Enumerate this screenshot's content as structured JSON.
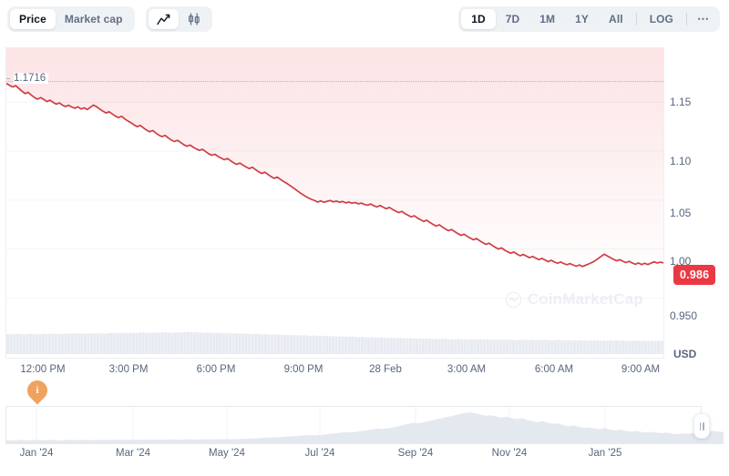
{
  "toolbar": {
    "metric_buttons": [
      {
        "label": "Price",
        "active": true
      },
      {
        "label": "Market cap",
        "active": false
      }
    ],
    "chart_type_buttons": [
      {
        "icon": "line-chart-icon",
        "active": true
      },
      {
        "icon": "candlestick-chart-icon",
        "active": false
      }
    ],
    "range_buttons": [
      {
        "label": "1D",
        "active": true
      },
      {
        "label": "7D",
        "active": false
      },
      {
        "label": "1M",
        "active": false
      },
      {
        "label": "1Y",
        "active": false
      },
      {
        "label": "All",
        "active": false
      }
    ],
    "log_label": "LOG",
    "more_label": "⋯"
  },
  "chart": {
    "ath_label": "1.1716",
    "current_price": "0.986",
    "currency": "USD",
    "watermark": "CoinMarketCap",
    "flag_label": "i",
    "accent_color": "#ea3943",
    "line_color": "#cf3d43",
    "flag_color": "#f0a35e"
  },
  "chart_data": {
    "type": "line",
    "title": "",
    "subtitle": "",
    "xlabel": "",
    "ylabel": "USD",
    "ylim": [
      0.93,
      1.1716
    ],
    "grid": true,
    "legend": false,
    "annotations": [
      {
        "type": "hline",
        "value": 1.1716,
        "label": "1.1716",
        "style": "dotted"
      },
      {
        "type": "price-badge",
        "value": 0.986,
        "label": "0.986"
      },
      {
        "type": "flag",
        "x": "12:00 PM",
        "label": "i"
      }
    ],
    "yticks": [
      1.15,
      1.1,
      1.05,
      1.0,
      0.95
    ],
    "ytick_labels": [
      "1.15",
      "1.10",
      "1.05",
      "1.00",
      "0.950"
    ],
    "xticks": [
      "12:00 PM",
      "3:00 PM",
      "6:00 PM",
      "9:00 PM",
      "28 Feb",
      "3:00 AM",
      "6:00 AM",
      "9:00 AM"
    ],
    "series": [
      {
        "name": "Price",
        "color": "#cf3d43",
        "fill": "rgba(234,57,67,0.10)",
        "values": [
          1.169,
          1.1672,
          1.1655,
          1.1668,
          1.164,
          1.1612,
          1.1588,
          1.16,
          1.1572,
          1.1548,
          1.153,
          1.1546,
          1.1528,
          1.1506,
          1.152,
          1.1498,
          1.148,
          1.1492,
          1.147,
          1.1455,
          1.1468,
          1.145,
          1.1438,
          1.1452,
          1.143,
          1.1442,
          1.1425,
          1.1448,
          1.147,
          1.1452,
          1.143,
          1.1408,
          1.139,
          1.1402,
          1.138,
          1.1358,
          1.1342,
          1.1356,
          1.133,
          1.1308,
          1.129,
          1.1268,
          1.125,
          1.1262,
          1.1238,
          1.1215,
          1.1198,
          1.121,
          1.1185,
          1.1162,
          1.1148,
          1.116,
          1.1135,
          1.1112,
          1.1098,
          1.111,
          1.1088,
          1.1065,
          1.105,
          1.1062,
          1.104,
          1.1022,
          1.1008,
          1.1018,
          1.0995,
          1.0972,
          1.0958,
          1.0968,
          1.0945,
          1.0928,
          1.0912,
          1.0925,
          1.0902,
          1.088,
          1.0865,
          1.0878,
          1.0856,
          1.0838,
          1.0822,
          1.0835,
          1.0812,
          1.079,
          1.0772,
          1.0785,
          1.0762,
          1.074,
          1.0722,
          1.0735,
          1.0712,
          1.069,
          1.0672,
          1.065,
          1.0628,
          1.0605,
          1.0582,
          1.056,
          1.054,
          1.0522,
          1.0508,
          1.0495,
          1.048,
          1.0492,
          1.0478,
          1.0488,
          1.0496,
          1.0482,
          1.049,
          1.0478,
          1.0486,
          1.0472,
          1.048,
          1.0468,
          1.0476,
          1.0462,
          1.047,
          1.0455,
          1.0448,
          1.046,
          1.0442,
          1.043,
          1.0445,
          1.0428,
          1.0412,
          1.0425,
          1.0405,
          1.0388,
          1.0372,
          1.0385,
          1.0362,
          1.0345,
          1.0328,
          1.034,
          1.0318,
          1.03,
          1.0282,
          1.0295,
          1.0272,
          1.0252,
          1.0235,
          1.0248,
          1.0225,
          1.0205,
          1.0188,
          1.02,
          1.0178,
          1.0158,
          1.014,
          1.0152,
          1.013,
          1.0112,
          1.0095,
          1.0108,
          1.0085,
          1.0065,
          1.0048,
          1.006,
          1.0038,
          1.0018,
          1.0,
          1.0012,
          0.999,
          0.9972,
          0.9958,
          0.997,
          0.9948,
          0.9932,
          0.9945,
          0.9928,
          0.9912,
          0.9925,
          0.9908,
          0.9892,
          0.9905,
          0.9888,
          0.9872,
          0.9885,
          0.9868,
          0.9855,
          0.9868,
          0.9852,
          0.984,
          0.9852,
          0.9838,
          0.9825,
          0.9838,
          0.9822,
          0.9835,
          0.9848,
          0.9862,
          0.988,
          0.9902,
          0.9925,
          0.9948,
          0.993,
          0.9912,
          0.9895,
          0.988,
          0.9892,
          0.9875,
          0.9862,
          0.9875,
          0.9858,
          0.9845,
          0.9858,
          0.9842,
          0.9855,
          0.9842,
          0.9856,
          0.987,
          0.9858,
          0.9866,
          0.986
        ]
      }
    ],
    "volume_series": {
      "name": "Volume",
      "color": "#e7ebf1",
      "values": [
        0.72,
        0.73,
        0.72,
        0.74,
        0.73,
        0.72,
        0.73,
        0.74,
        0.73,
        0.72,
        0.73,
        0.74,
        0.73,
        0.74,
        0.75,
        0.74,
        0.73,
        0.74,
        0.75,
        0.74,
        0.75,
        0.76,
        0.75,
        0.74,
        0.75,
        0.76,
        0.75,
        0.76,
        0.77,
        0.76,
        0.75,
        0.76,
        0.77,
        0.76,
        0.77,
        0.78,
        0.77,
        0.76,
        0.77,
        0.78,
        0.77,
        0.78,
        0.79,
        0.78,
        0.77,
        0.78,
        0.79,
        0.78,
        0.79,
        0.8,
        0.79,
        0.78,
        0.79,
        0.8,
        0.79,
        0.8,
        0.81,
        0.8,
        0.79,
        0.8,
        0.79,
        0.78,
        0.79,
        0.78,
        0.77,
        0.78,
        0.77,
        0.76,
        0.77,
        0.76,
        0.75,
        0.76,
        0.75,
        0.74,
        0.75,
        0.74,
        0.73,
        0.74,
        0.73,
        0.72,
        0.73,
        0.72,
        0.71,
        0.72,
        0.71,
        0.7,
        0.71,
        0.7,
        0.69,
        0.7,
        0.69,
        0.68,
        0.69,
        0.68,
        0.67,
        0.68,
        0.67,
        0.66,
        0.67,
        0.66,
        0.65,
        0.66,
        0.65,
        0.64,
        0.65,
        0.64,
        0.63,
        0.64,
        0.63,
        0.62,
        0.63,
        0.62,
        0.61,
        0.62,
        0.61,
        0.6,
        0.61,
        0.6,
        0.59,
        0.6,
        0.59,
        0.58,
        0.59,
        0.58,
        0.57,
        0.58,
        0.57,
        0.56,
        0.57,
        0.56,
        0.57,
        0.56,
        0.55,
        0.56,
        0.55,
        0.56,
        0.55,
        0.54,
        0.55,
        0.54,
        0.55,
        0.54,
        0.53,
        0.54,
        0.55,
        0.54,
        0.53,
        0.54,
        0.53,
        0.54,
        0.53,
        0.52,
        0.53,
        0.52,
        0.53,
        0.52,
        0.53,
        0.52,
        0.51,
        0.52,
        0.53,
        0.52,
        0.51,
        0.52,
        0.51,
        0.52,
        0.51,
        0.52,
        0.51,
        0.5,
        0.51,
        0.52,
        0.51,
        0.5,
        0.51,
        0.5,
        0.51,
        0.5,
        0.51,
        0.5,
        0.49,
        0.5,
        0.51,
        0.5,
        0.49,
        0.5,
        0.49,
        0.5,
        0.49,
        0.5,
        0.49,
        0.5,
        0.49,
        0.48,
        0.49,
        0.5,
        0.49,
        0.48,
        0.49,
        0.48,
        0.49,
        0.48,
        0.49,
        0.48
      ]
    }
  },
  "navigator": {
    "xticks": [
      "Jan '24",
      "Mar '24",
      "May '24",
      "Jul '24",
      "Sep '24",
      "Nov '24",
      "Jan '25"
    ],
    "handle_left_icon": "drag-handle-icon",
    "handle_right_icon": "drag-handle-icon",
    "selection_start_pct": 0,
    "selection_end_pct": 97,
    "series": {
      "name": "Market cap history",
      "color": "#e4e8ef",
      "values": [
        0.04,
        0.04,
        0.04,
        0.05,
        0.04,
        0.04,
        0.05,
        0.04,
        0.04,
        0.05,
        0.04,
        0.04,
        0.05,
        0.05,
        0.04,
        0.05,
        0.05,
        0.04,
        0.05,
        0.05,
        0.05,
        0.05,
        0.06,
        0.05,
        0.05,
        0.06,
        0.05,
        0.06,
        0.06,
        0.06,
        0.06,
        0.06,
        0.07,
        0.06,
        0.06,
        0.07,
        0.07,
        0.06,
        0.07,
        0.07,
        0.07,
        0.08,
        0.07,
        0.08,
        0.08,
        0.08,
        0.09,
        0.09,
        0.1,
        0.11,
        0.12,
        0.13,
        0.14,
        0.15,
        0.16,
        0.17,
        0.18,
        0.2,
        0.21,
        0.22,
        0.21,
        0.22,
        0.24,
        0.26,
        0.28,
        0.3,
        0.32,
        0.31,
        0.33,
        0.36,
        0.38,
        0.41,
        0.44,
        0.42,
        0.45,
        0.48,
        0.52,
        0.56,
        0.6,
        0.64,
        0.62,
        0.66,
        0.7,
        0.74,
        0.78,
        0.82,
        0.86,
        0.9,
        0.94,
        0.98,
        1.0,
        0.96,
        0.92,
        0.88,
        0.9,
        0.86,
        0.82,
        0.85,
        0.8,
        0.76,
        0.8,
        0.74,
        0.7,
        0.66,
        0.7,
        0.64,
        0.6,
        0.62,
        0.56,
        0.52,
        0.55,
        0.5,
        0.46,
        0.48,
        0.44,
        0.42,
        0.45,
        0.41,
        0.38,
        0.4,
        0.36,
        0.34,
        0.36,
        0.33,
        0.31,
        0.33,
        0.3,
        0.28,
        0.3,
        0.27,
        0.25,
        0.27,
        0.26,
        0.28,
        0.3,
        0.32,
        0.34,
        0.36,
        0.34,
        0.32
      ]
    }
  }
}
